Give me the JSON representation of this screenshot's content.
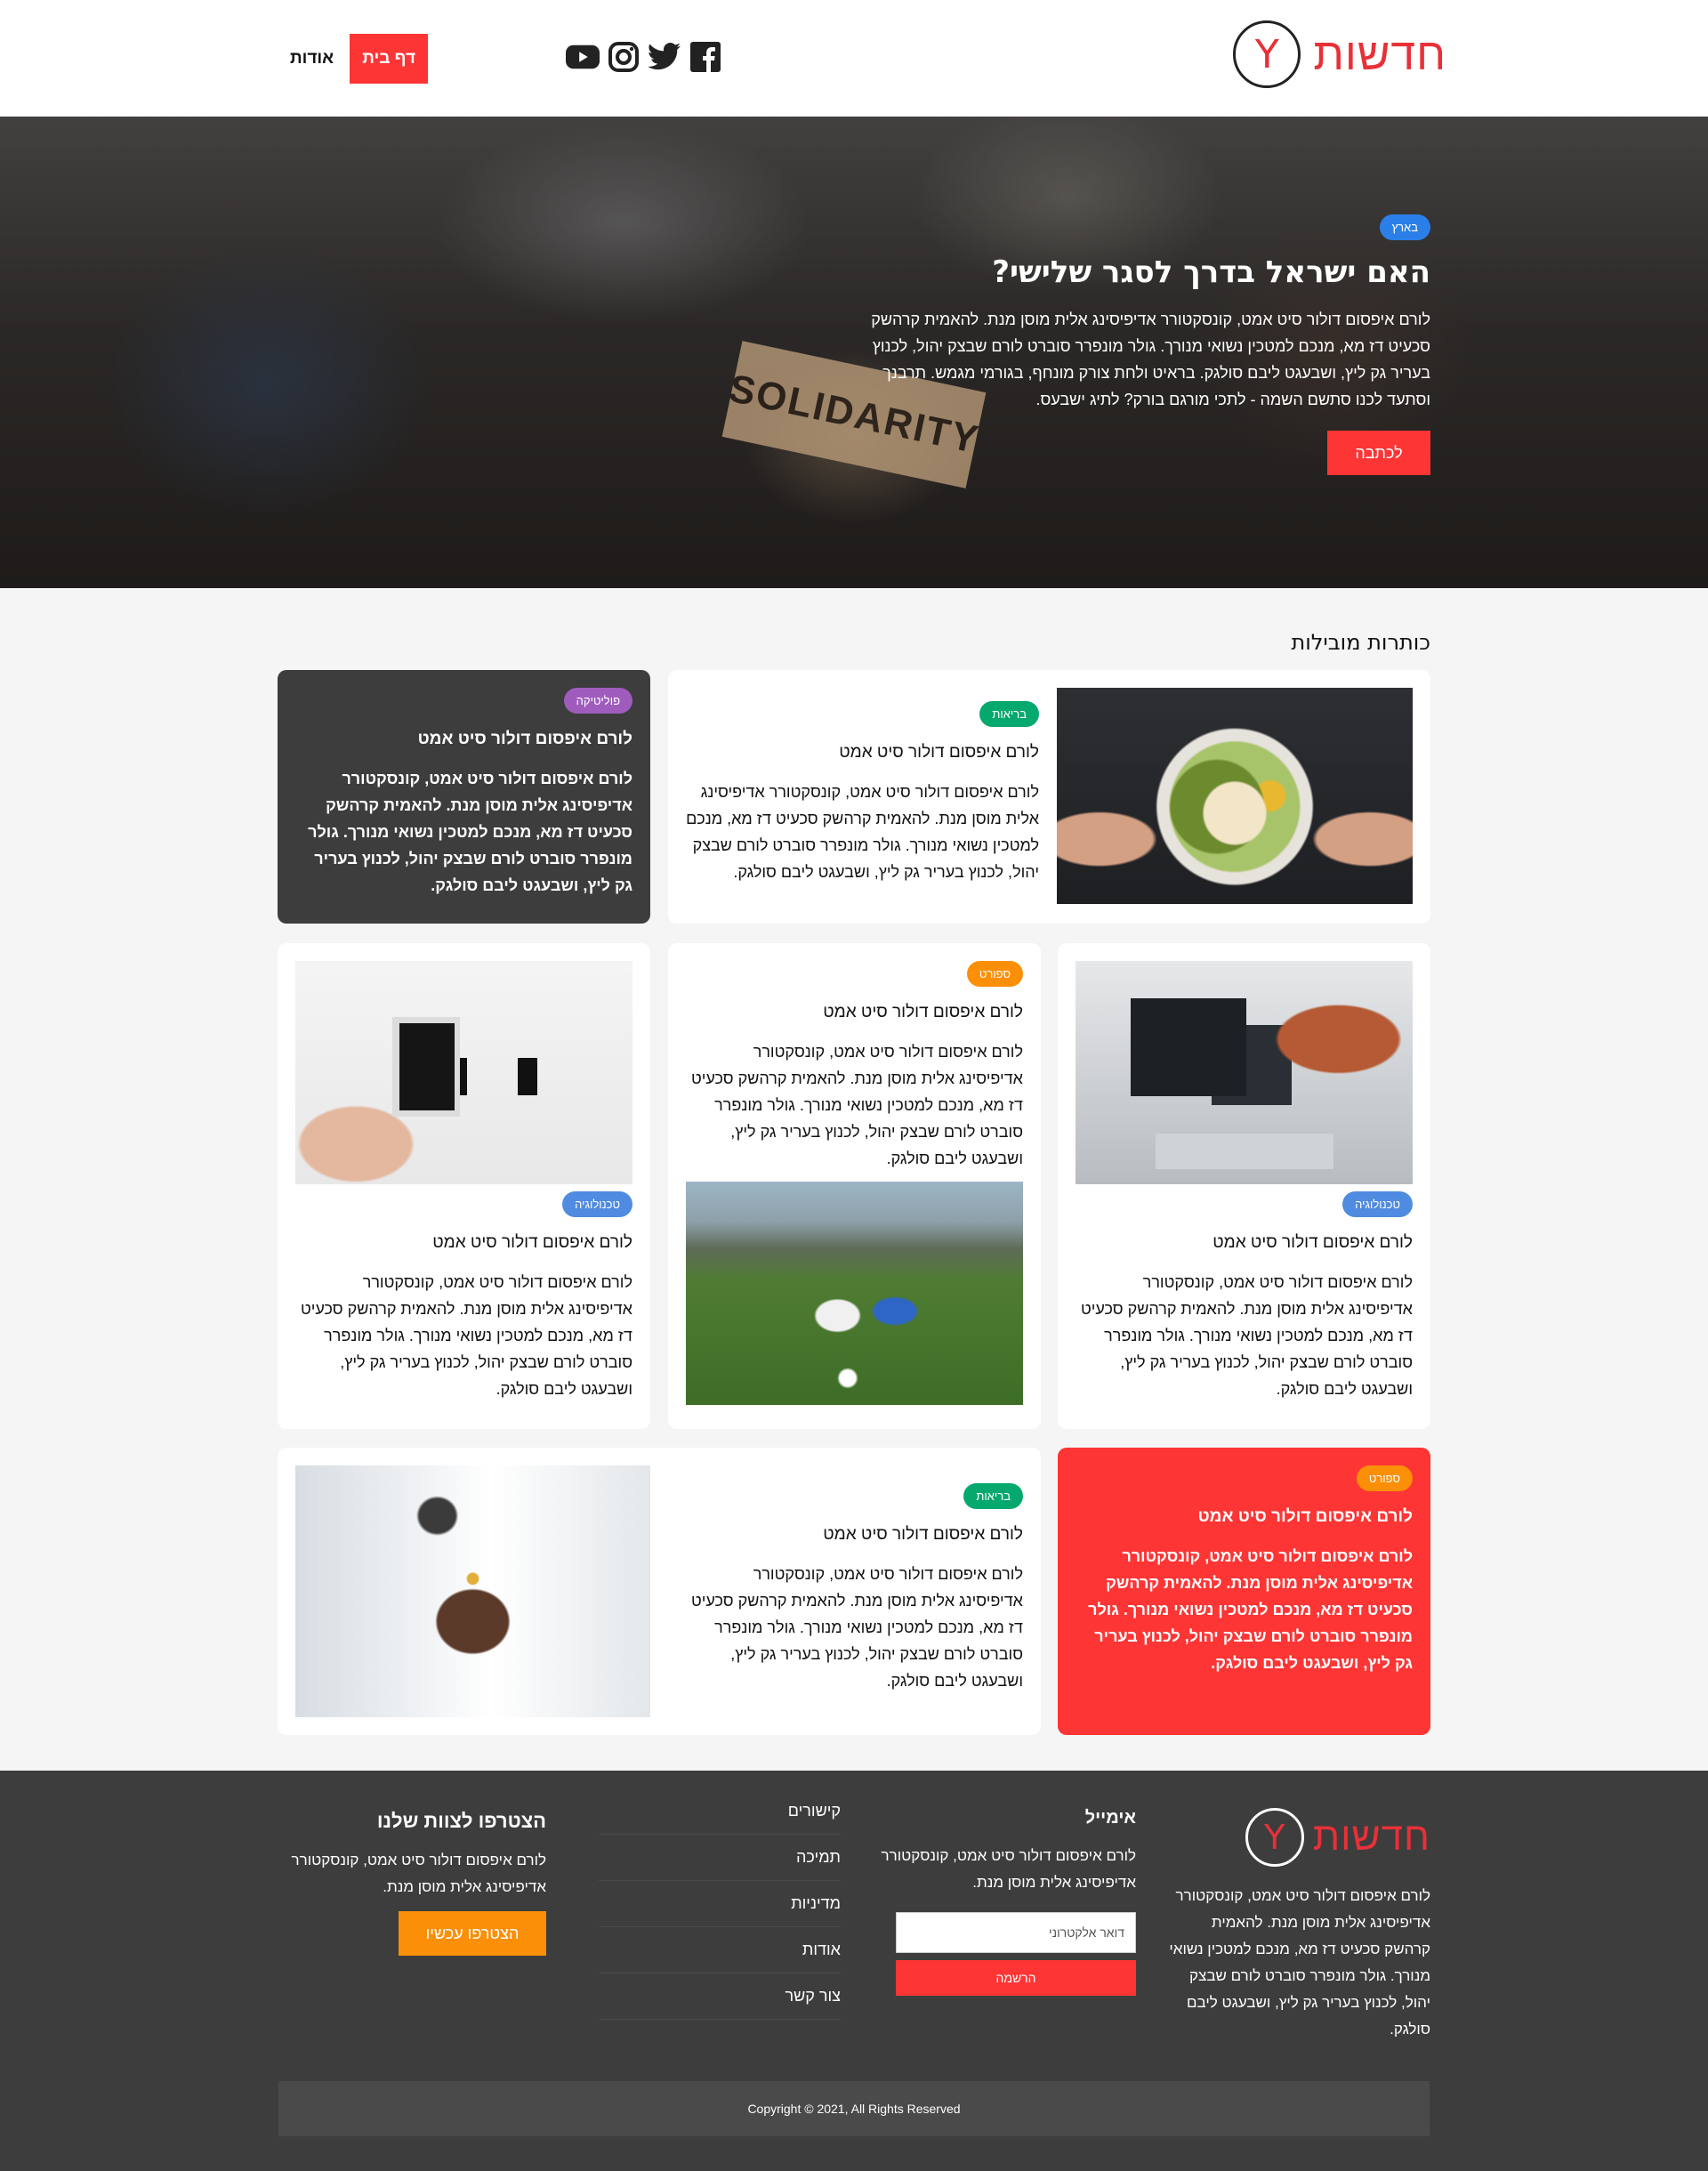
{
  "header": {
    "logo_text": "חדשות",
    "logo_letter": "Y",
    "nav": {
      "home": "דף בית",
      "about": "אודות"
    },
    "social": [
      "facebook-icon",
      "twitter-icon",
      "instagram-icon",
      "youtube-icon"
    ]
  },
  "hero": {
    "tag": "בארץ",
    "title": "האם ישראל בדרך לסגר שלישי?",
    "text": "לורם איפסום דולור סיט אמט, קונסקטורר אדיפיסינג אלית מוסן מנת. להאמית קרהשק סכעיט דז מא, מנכם למטכין נשואי מנורך. גולר מונפרר סוברט לורם שבצק יהול, לכנוץ בעריר גק ליץ, ושבעגט ליבם סולגק. בראיט ולחת צורק מונחף, בגורמי מגמש. תרבנך וסתעד לכנו סתשם השמה - לתכי מורגם בורק? לתיג ישבעס.",
    "sign_text": "SOLIDARITY",
    "button": "לכתבה"
  },
  "main": {
    "section_title": "כותרות מובילות",
    "cards": [
      {
        "tag": "בריאות",
        "title": "לורם איפסום דולור סיט אמט",
        "text": "לורם איפסום דולור סיט אמט, קונסקטורר אדיפיסינג אלית מוסן מנת. להאמית קרהשק סכעיט דז מא, מנכם למטכין נשואי מנורך. גולר מונפרר סוברט לורם שבצק יהול, לכנוץ בעריר גק ליץ, ושבעגט ליבם סולגק."
      },
      {
        "tag": "פוליטיקה",
        "title": "לורם איפסום דולור סיט אמט",
        "text": "לורם איפסום דולור סיט אמט, קונסקטורר אדיפיסינג אלית מוסן מנת. להאמית קרהשק סכעיט דז מא, מנכם למטכין נשואי מנורך. גולר מונפרר סוברט לורם שבצק יהול, לכנוץ בעריר גק ליץ, ושבעגט ליבם סולגק."
      },
      {
        "tag": "טכנולוגיה",
        "title": "לורם איפסום דולור סיט אמט",
        "text": "לורם איפסום דולור סיט אמט, קונסקטורר אדיפיסינג אלית מוסן מנת. להאמית קרהשק סכעיט דז מא, מנכם למטכין נשואי מנורך. גולר מונפרר סוברט לורם שבצק יהול, לכנוץ בעריר גק ליץ, ושבעגט ליבם סולגק."
      },
      {
        "tag": "ספורט",
        "title": "לורם איפסום דולור סיט אמט",
        "text": "לורם איפסום דולור סיט אמט, קונסקטורר אדיפיסינג אלית מוסן מנת. להאמית קרהשק סכעיט דז מא, מנכם למטכין נשואי מנורך. גולר מונפרר סוברט לורם שבצק יהול, לכנוץ בעריר גק ליץ, ושבעגט ליבם סולגק."
      },
      {
        "tag": "טכנולוגיה",
        "title": "לורם איפסום דולור סיט אמט",
        "text": "לורם איפסום דולור סיט אמט, קונסקטורר אדיפיסינג אלית מוסן מנת. להאמית קרהשק סכעיט דז מא, מנכם למטכין נשואי מנורך. גולר מונפרר סוברט לורם שבצק יהול, לכנוץ בעריר גק ליץ, ושבעגט ליבם סולגק."
      },
      {
        "tag": "ספורט",
        "title": "לורם איפסום דולור סיט אמט",
        "text": "לורם איפסום דולור סיט אמט, קונסקטורר אדיפיסינג אלית מוסן מנת. להאמית קרהשק סכעיט דז מא, מנכם למטכין נשואי מנורך. גולר מונפרר סוברט לורם שבצק יהול, לכנוץ בעריר גק ליץ, ושבעגט ליבם סולגק."
      },
      {
        "tag": "בריאות",
        "title": "לורם איפסום דולור סיט אמט",
        "text": "לורם איפסום דולור סיט אמט, קונסקטורר אדיפיסינג אלית מוסן מנת. להאמית קרהשק סכעיט דז מא, מנכם למטכין נשואי מנורך. גולר מונפרר סוברט לורם שבצק יהול, לכנוץ בעריר גק ליץ, ושבעגט ליבם סולגק."
      }
    ]
  },
  "footer": {
    "about_text": "לורם איפסום דולור סיט אמט, קונסקטורר אדיפיסינג אלית מוסן מנת. להאמית קרהשק סכעיט דז מא, מנכם למטכין נשואי מנורך. גולר מונפרר סוברט לורם שבצק יהול, לכנוץ בעריר גק ליץ, ושבעגט ליבם סולגק.",
    "email_title": "אימייל",
    "email_text": "לורם איפסום דולור סיט אמט, קונסקטורר אדיפיסינג אלית מוסן מנת.",
    "email_placeholder": "דואר אלקטרוני",
    "register_button": "הרשמה",
    "links": [
      "קישורים",
      "תמיכה",
      "מדיניות",
      "אודות",
      "צור קשר"
    ],
    "join_title": "הצטרפו לצוות שלנו",
    "join_text": "לורם איפסום דולור סיט אמט, קונסקטורר אדיפיסינג אלית מוסן מנת.",
    "join_button": "הצטרפו עכשיו",
    "copyright": "Copyright © 2021, All Rights Reserved"
  },
  "colors": {
    "accent": "#fd3535",
    "dark": "#3d3d3d",
    "orange": "#fb8f07",
    "green": "#05a86d",
    "blue": "#2b7fe8",
    "purple": "#a05cbd"
  }
}
